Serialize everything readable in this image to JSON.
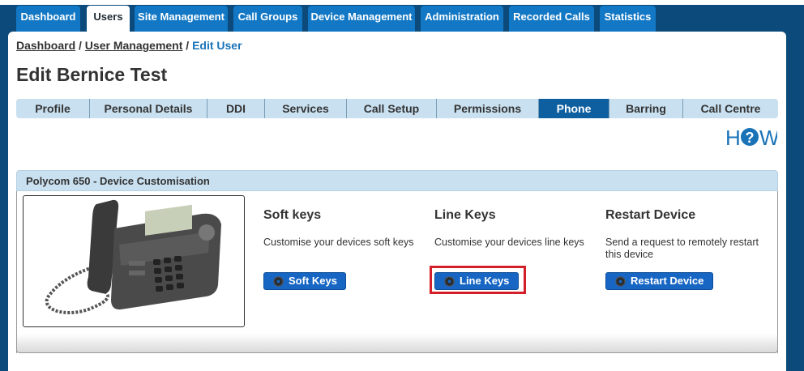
{
  "nav": {
    "tabs": [
      {
        "label": "Dashboard"
      },
      {
        "label": "Users"
      },
      {
        "label": "Site Management"
      },
      {
        "label": "Call Groups"
      },
      {
        "label": "Device Management"
      },
      {
        "label": "Administration"
      },
      {
        "label": "Recorded Calls"
      },
      {
        "label": "Statistics"
      }
    ],
    "active": "Users"
  },
  "breadcrumb": {
    "items": [
      "Dashboard",
      "User Management"
    ],
    "current": "Edit User",
    "separator": "/"
  },
  "page_title": "Edit Bernice Test",
  "subtabs": {
    "items": [
      {
        "label": "Profile"
      },
      {
        "label": "Personal Details"
      },
      {
        "label": "DDI"
      },
      {
        "label": "Services"
      },
      {
        "label": "Call Setup"
      },
      {
        "label": "Permissions"
      },
      {
        "label": "Phone"
      },
      {
        "label": "Barring"
      },
      {
        "label": "Call Centre"
      }
    ],
    "active": "Phone"
  },
  "how_logo": {
    "left": "H",
    "right": "W"
  },
  "section": {
    "title": "Polycom 650 - Device Customisation",
    "columns": [
      {
        "heading": "Soft keys",
        "description": "Customise your devices soft keys",
        "button": "Soft Keys"
      },
      {
        "heading": "Line Keys",
        "description": "Customise your devices line keys",
        "button": "Line Keys"
      },
      {
        "heading": "Restart Device",
        "description": "Send a request to remotely restart this device",
        "button": "Restart Device"
      }
    ]
  },
  "colors": {
    "nav_bg": "#0b4a7a",
    "tab_blue": "#1277c4",
    "subtab_bg": "#c9e0f0",
    "subtab_active": "#0e5fa0",
    "button_blue": "#1766c4",
    "highlight_red": "#d21f2a"
  },
  "icons": [
    "gear-icon",
    "how-question-icon",
    "phone-image"
  ]
}
